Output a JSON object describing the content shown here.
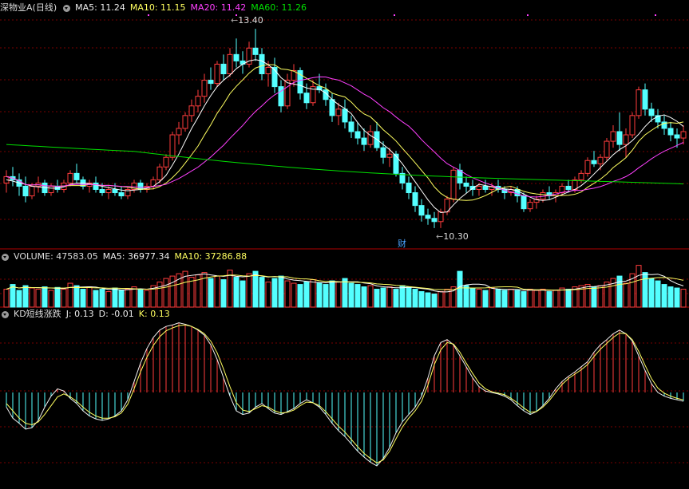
{
  "colors": {
    "up": "#ff3d3d",
    "down": "#54ffff",
    "ma5": "#ffffff",
    "ma10": "#ffff60",
    "ma20": "#ff40ff",
    "ma60": "#00e000",
    "grid": "#7a0000",
    "separator": "#b00000"
  },
  "price_panel": {
    "title": "深物业A(日线)",
    "ma5": "MA5: 11.24",
    "ma10": "MA10: 11.15",
    "ma20": "MA20: 11.42",
    "ma60": "MA60: 11.26",
    "high_label": "13.40",
    "low_label": "10.30",
    "event_marker": "财"
  },
  "volume_panel": {
    "volume": "VOLUME: 47583.05",
    "ma5": "MA5: 36977.34",
    "ma10": "MA10: 37286.88"
  },
  "kd_panel": {
    "title": "KD短线涨跌",
    "j": "J: 0.13",
    "d": "D: -0.01",
    "k": "K: 0.13"
  },
  "chart_data": {
    "type": "candlestick",
    "price_range": [
      10.0,
      13.6
    ],
    "ohlc": [
      [
        11.0,
        11.2,
        10.85,
        11.1
      ],
      [
        11.1,
        11.25,
        10.95,
        11.05
      ],
      [
        11.05,
        11.15,
        10.8,
        10.95
      ],
      [
        10.95,
        11.1,
        10.7,
        10.8
      ],
      [
        10.8,
        11.0,
        10.75,
        10.95
      ],
      [
        10.95,
        11.1,
        10.85,
        11.0
      ],
      [
        11.0,
        11.05,
        10.8,
        10.85
      ],
      [
        10.85,
        11.0,
        10.8,
        10.95
      ],
      [
        10.95,
        11.05,
        10.85,
        10.9
      ],
      [
        10.9,
        11.05,
        10.85,
        11.0
      ],
      [
        11.0,
        11.2,
        10.95,
        11.15
      ],
      [
        11.15,
        11.3,
        11.0,
        11.05
      ],
      [
        11.05,
        11.1,
        10.9,
        10.95
      ],
      [
        10.95,
        11.05,
        10.85,
        11.0
      ],
      [
        11.0,
        11.1,
        10.85,
        10.9
      ],
      [
        10.9,
        11.0,
        10.8,
        10.85
      ],
      [
        10.85,
        10.95,
        10.75,
        10.9
      ],
      [
        10.9,
        11.0,
        10.8,
        10.85
      ],
      [
        10.85,
        10.95,
        10.75,
        10.8
      ],
      [
        10.8,
        10.95,
        10.75,
        10.9
      ],
      [
        10.9,
        11.05,
        10.85,
        11.0
      ],
      [
        11.0,
        11.05,
        10.85,
        10.9
      ],
      [
        10.9,
        11.0,
        10.85,
        10.95
      ],
      [
        10.95,
        11.1,
        10.9,
        11.05
      ],
      [
        11.05,
        11.3,
        11.0,
        11.25
      ],
      [
        11.25,
        11.45,
        11.2,
        11.4
      ],
      [
        11.4,
        11.8,
        11.35,
        11.75
      ],
      [
        11.75,
        11.95,
        11.6,
        11.85
      ],
      [
        11.85,
        12.1,
        11.8,
        12.05
      ],
      [
        12.05,
        12.3,
        11.95,
        12.2
      ],
      [
        12.2,
        12.45,
        12.1,
        12.35
      ],
      [
        12.35,
        12.7,
        12.25,
        12.6
      ],
      [
        12.6,
        12.8,
        12.45,
        12.55
      ],
      [
        12.55,
        12.9,
        12.5,
        12.85
      ],
      [
        12.85,
        13.0,
        12.6,
        12.7
      ],
      [
        12.7,
        13.1,
        12.65,
        13.0
      ],
      [
        13.0,
        13.25,
        12.8,
        12.9
      ],
      [
        12.9,
        13.05,
        12.7,
        12.85
      ],
      [
        12.85,
        13.2,
        12.8,
        13.1
      ],
      [
        13.1,
        13.4,
        12.9,
        13.0
      ],
      [
        13.0,
        13.1,
        12.6,
        12.7
      ],
      [
        12.7,
        12.9,
        12.5,
        12.8
      ],
      [
        12.8,
        12.95,
        12.4,
        12.5
      ],
      [
        12.5,
        12.6,
        12.1,
        12.2
      ],
      [
        12.2,
        12.7,
        12.15,
        12.6
      ],
      [
        12.6,
        12.85,
        12.5,
        12.75
      ],
      [
        12.75,
        12.8,
        12.3,
        12.4
      ],
      [
        12.4,
        12.55,
        12.15,
        12.25
      ],
      [
        12.25,
        12.6,
        12.2,
        12.5
      ],
      [
        12.5,
        12.7,
        12.4,
        12.45
      ],
      [
        12.45,
        12.55,
        12.2,
        12.3
      ],
      [
        12.3,
        12.4,
        11.95,
        12.05
      ],
      [
        12.05,
        12.25,
        11.9,
        12.15
      ],
      [
        12.15,
        12.3,
        11.85,
        11.95
      ],
      [
        11.95,
        12.05,
        11.7,
        11.8
      ],
      [
        11.8,
        11.95,
        11.6,
        11.7
      ],
      [
        11.7,
        11.85,
        11.5,
        11.6
      ],
      [
        11.6,
        11.9,
        11.55,
        11.8
      ],
      [
        11.8,
        11.95,
        11.5,
        11.55
      ],
      [
        11.55,
        11.65,
        11.3,
        11.4
      ],
      [
        11.4,
        11.55,
        11.25,
        11.45
      ],
      [
        11.45,
        11.5,
        11.1,
        11.15
      ],
      [
        11.15,
        11.25,
        10.9,
        11.0
      ],
      [
        11.0,
        11.1,
        10.75,
        10.85
      ],
      [
        10.85,
        10.95,
        10.55,
        10.65
      ],
      [
        10.65,
        10.75,
        10.4,
        10.5
      ],
      [
        10.5,
        10.6,
        10.35,
        10.45
      ],
      [
        10.45,
        10.55,
        10.3,
        10.4
      ],
      [
        10.4,
        10.6,
        10.3,
        10.55
      ],
      [
        10.55,
        10.8,
        10.5,
        10.75
      ],
      [
        10.75,
        11.25,
        10.7,
        11.2
      ],
      [
        11.2,
        11.3,
        10.9,
        11.0
      ],
      [
        11.0,
        11.1,
        10.85,
        10.95
      ],
      [
        10.95,
        11.05,
        10.8,
        10.9
      ],
      [
        10.9,
        11.0,
        10.8,
        10.95
      ],
      [
        10.95,
        11.05,
        10.85,
        10.9
      ],
      [
        10.9,
        11.0,
        10.8,
        10.95
      ],
      [
        10.95,
        11.05,
        10.85,
        10.9
      ],
      [
        10.9,
        10.95,
        10.75,
        10.85
      ],
      [
        10.85,
        10.95,
        10.8,
        10.9
      ],
      [
        10.9,
        10.95,
        10.7,
        10.8
      ],
      [
        10.8,
        10.85,
        10.55,
        10.6
      ],
      [
        10.6,
        10.75,
        10.55,
        10.7
      ],
      [
        10.7,
        10.8,
        10.6,
        10.75
      ],
      [
        10.75,
        10.9,
        10.7,
        10.85
      ],
      [
        10.85,
        10.95,
        10.75,
        10.8
      ],
      [
        10.8,
        10.9,
        10.7,
        10.85
      ],
      [
        10.85,
        11.0,
        10.8,
        10.95
      ],
      [
        10.95,
        11.05,
        10.85,
        10.9
      ],
      [
        10.9,
        11.1,
        10.85,
        11.05
      ],
      [
        11.05,
        11.2,
        11.0,
        11.15
      ],
      [
        11.15,
        11.4,
        11.1,
        11.35
      ],
      [
        11.35,
        11.5,
        11.25,
        11.3
      ],
      [
        11.3,
        11.45,
        11.2,
        11.4
      ],
      [
        11.4,
        11.7,
        11.35,
        11.65
      ],
      [
        11.65,
        11.9,
        11.55,
        11.8
      ],
      [
        11.8,
        12.1,
        11.5,
        11.6
      ],
      [
        11.6,
        11.85,
        11.4,
        11.75
      ],
      [
        11.75,
        12.1,
        11.7,
        12.05
      ],
      [
        12.05,
        12.5,
        12.0,
        12.45
      ],
      [
        12.45,
        12.55,
        12.05,
        12.15
      ],
      [
        12.15,
        12.25,
        11.95,
        12.05
      ],
      [
        12.05,
        12.15,
        11.85,
        11.95
      ],
      [
        11.95,
        12.05,
        11.75,
        11.85
      ],
      [
        11.85,
        11.95,
        11.65,
        11.75
      ],
      [
        11.75,
        11.85,
        11.55,
        11.7
      ],
      [
        11.7,
        11.9,
        11.6,
        11.8
      ]
    ],
    "volume": [
      30,
      38,
      28,
      36,
      32,
      30,
      34,
      28,
      33,
      30,
      40,
      36,
      30,
      34,
      28,
      30,
      26,
      32,
      28,
      30,
      34,
      30,
      28,
      36,
      42,
      48,
      52,
      56,
      60,
      50,
      54,
      58,
      48,
      52,
      46,
      62,
      50,
      44,
      56,
      60,
      50,
      42,
      48,
      52,
      44,
      40,
      38,
      42,
      46,
      40,
      38,
      44,
      42,
      48,
      40,
      38,
      34,
      36,
      30,
      32,
      34,
      30,
      36,
      34,
      30,
      26,
      24,
      22,
      26,
      30,
      34,
      60,
      36,
      32,
      30,
      28,
      32,
      30,
      28,
      30,
      28,
      26,
      30,
      28,
      30,
      26,
      28,
      32,
      30,
      34,
      36,
      38,
      34,
      36,
      42,
      48,
      52,
      40,
      56,
      70,
      58,
      48,
      44,
      38,
      34,
      32,
      30
    ],
    "kd_j": [
      -0.2,
      -0.35,
      -0.42,
      -0.5,
      -0.48,
      -0.38,
      -0.2,
      -0.05,
      0.05,
      0.02,
      -0.08,
      -0.15,
      -0.25,
      -0.32,
      -0.36,
      -0.38,
      -0.36,
      -0.32,
      -0.25,
      -0.1,
      0.15,
      0.4,
      0.6,
      0.75,
      0.85,
      0.9,
      0.92,
      0.95,
      0.93,
      0.9,
      0.85,
      0.78,
      0.65,
      0.45,
      0.2,
      -0.05,
      -0.25,
      -0.3,
      -0.28,
      -0.2,
      -0.15,
      -0.22,
      -0.28,
      -0.3,
      -0.26,
      -0.22,
      -0.15,
      -0.1,
      -0.14,
      -0.2,
      -0.3,
      -0.42,
      -0.52,
      -0.6,
      -0.7,
      -0.8,
      -0.88,
      -0.95,
      -1.0,
      -0.9,
      -0.75,
      -0.55,
      -0.4,
      -0.3,
      -0.2,
      -0.05,
      0.2,
      0.5,
      0.68,
      0.72,
      0.65,
      0.5,
      0.35,
      0.2,
      0.08,
      0.02,
      0.0,
      -0.02,
      -0.05,
      -0.1,
      -0.18,
      -0.25,
      -0.3,
      -0.26,
      -0.18,
      -0.08,
      0.05,
      0.15,
      0.22,
      0.28,
      0.35,
      0.42,
      0.55,
      0.65,
      0.72,
      0.8,
      0.85,
      0.8,
      0.7,
      0.5,
      0.3,
      0.12,
      0.0,
      -0.05,
      -0.08,
      -0.1,
      -0.12
    ],
    "kd_k": [
      -0.15,
      -0.25,
      -0.35,
      -0.42,
      -0.44,
      -0.4,
      -0.3,
      -0.18,
      -0.06,
      -0.02,
      -0.06,
      -0.12,
      -0.2,
      -0.27,
      -0.32,
      -0.35,
      -0.35,
      -0.33,
      -0.28,
      -0.16,
      0.05,
      0.28,
      0.48,
      0.64,
      0.76,
      0.84,
      0.88,
      0.91,
      0.92,
      0.9,
      0.86,
      0.8,
      0.7,
      0.54,
      0.32,
      0.08,
      -0.14,
      -0.24,
      -0.26,
      -0.22,
      -0.18,
      -0.2,
      -0.25,
      -0.28,
      -0.27,
      -0.24,
      -0.18,
      -0.13,
      -0.14,
      -0.18,
      -0.26,
      -0.36,
      -0.46,
      -0.54,
      -0.64,
      -0.74,
      -0.83,
      -0.9,
      -0.96,
      -0.92,
      -0.8,
      -0.63,
      -0.47,
      -0.35,
      -0.25,
      -0.12,
      0.1,
      0.38,
      0.58,
      0.68,
      0.66,
      0.55,
      0.4,
      0.26,
      0.13,
      0.05,
      0.01,
      -0.01,
      -0.03,
      -0.08,
      -0.14,
      -0.21,
      -0.27,
      -0.26,
      -0.2,
      -0.11,
      0.0,
      0.11,
      0.19,
      0.25,
      0.31,
      0.38,
      0.49,
      0.59,
      0.67,
      0.75,
      0.81,
      0.8,
      0.72,
      0.56,
      0.37,
      0.19,
      0.06,
      -0.01,
      -0.05,
      -0.08,
      -0.1
    ],
    "ma5": [
      11.05,
      11.03,
      11.0,
      10.98,
      10.95,
      10.94,
      10.93,
      10.92,
      10.92,
      10.94,
      10.98,
      11.0,
      11.0,
      10.99,
      10.97,
      10.95,
      10.93,
      10.91,
      10.89,
      10.88,
      10.89,
      10.9,
      10.92,
      10.95,
      11.02,
      11.12,
      11.28,
      11.45,
      11.65,
      11.85,
      12.02,
      12.2,
      12.36,
      12.5,
      12.6,
      12.68,
      12.78,
      12.85,
      12.9,
      12.92,
      12.9,
      12.84,
      12.76,
      12.64,
      12.56,
      12.54,
      12.52,
      12.48,
      12.46,
      12.46,
      12.4,
      12.3,
      12.22,
      12.16,
      12.08,
      11.94,
      11.82,
      11.74,
      11.68,
      11.6,
      11.52,
      11.42,
      11.3,
      11.16,
      11.02,
      10.88,
      10.74,
      10.62,
      10.54,
      10.55,
      10.66,
      10.76,
      10.84,
      10.92,
      10.98,
      10.96,
      10.94,
      10.92,
      10.91,
      10.9,
      10.88,
      10.83,
      10.78,
      10.74,
      10.73,
      10.74,
      10.78,
      10.82,
      10.86,
      10.9,
      10.96,
      11.04,
      11.14,
      11.24,
      11.34,
      11.44,
      11.52,
      11.58,
      11.66,
      11.76,
      11.88,
      11.98,
      12.04,
      12.06,
      12.02,
      11.96,
      11.88
    ]
  }
}
